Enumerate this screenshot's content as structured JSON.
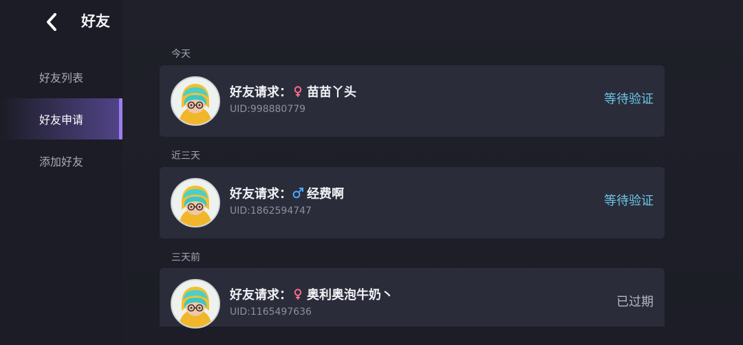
{
  "header": {
    "title": "好友",
    "back_icon": "chevron-left-icon"
  },
  "sidebar": {
    "items": [
      {
        "label": "好友列表"
      },
      {
        "label": "好友申请"
      },
      {
        "label": "添加好友"
      }
    ],
    "active_index": 1
  },
  "colors": {
    "accent": "#9b7df2",
    "pending": "#6bc6e6",
    "expired": "#b5b7c2",
    "female": "#ff6b8b",
    "male": "#4aa8ff"
  },
  "sections": [
    {
      "label": "今天",
      "request": {
        "prefix": "好友请求：",
        "gender": "female",
        "name": "苗苗丫头",
        "uid": "UID:998880779",
        "status": "等待验证",
        "status_type": "pending"
      }
    },
    {
      "label": "近三天",
      "request": {
        "prefix": "好友请求：",
        "gender": "male",
        "name": "经费啊",
        "uid": "UID:1862594747",
        "status": "等待验证",
        "status_type": "pending"
      }
    },
    {
      "label": "三天前",
      "request": {
        "prefix": "好友请求：",
        "gender": "female",
        "name": "奥利奥泡牛奶丶",
        "uid": "UID:1165497636",
        "status": "已过期",
        "status_type": "expired"
      }
    }
  ]
}
